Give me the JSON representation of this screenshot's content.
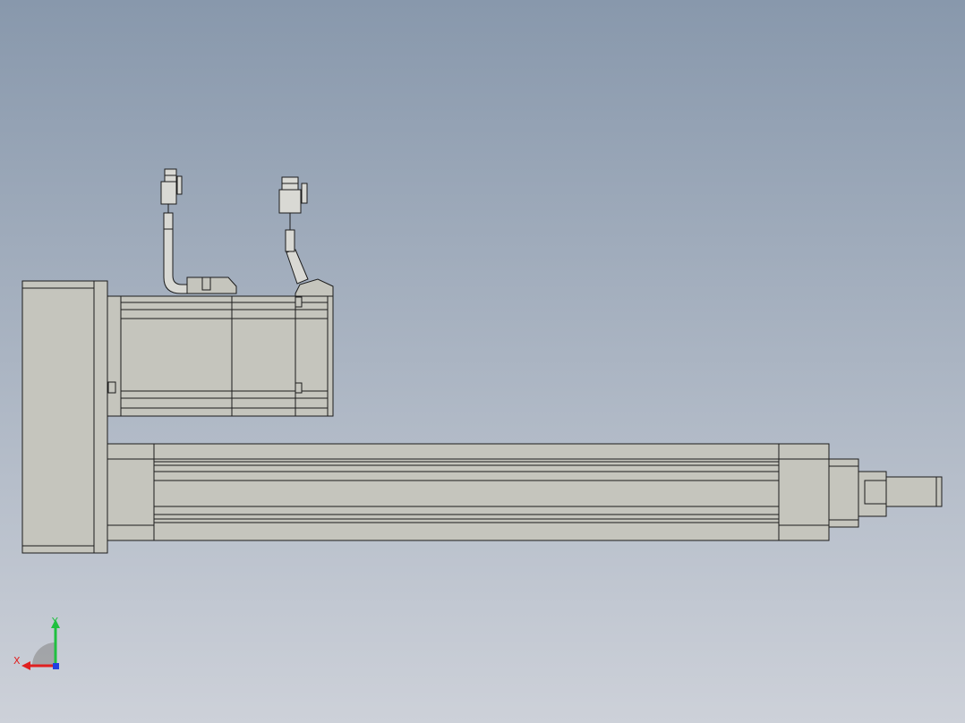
{
  "viewport": {
    "background_top": "#8898ac",
    "background_bottom": "#cdd1d9"
  },
  "model": {
    "body_color": "#c5c5bd",
    "body_shade": "#a9a9a1",
    "edge_color": "#1c1c1c",
    "cable_color": "#d9d9d4"
  },
  "triad": {
    "x_label": "X",
    "y_label": "Y",
    "x_color": "#e02020",
    "y_color": "#20c040",
    "z_color": "#2040e0"
  }
}
